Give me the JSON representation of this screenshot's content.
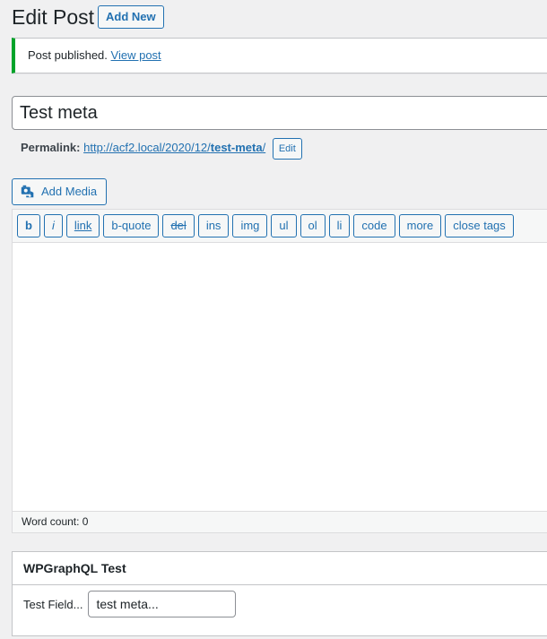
{
  "header": {
    "title": "Edit Post",
    "add_new_label": "Add New"
  },
  "notice": {
    "message": "Post published.",
    "link_label": "View post",
    "accent_color": "#00a32a"
  },
  "post": {
    "title_value": "Test meta",
    "permalink_label": "Permalink:",
    "permalink_base": "http://acf2.local/2020/12/",
    "permalink_slug": "test-meta",
    "permalink_trailing": "/",
    "edit_slug_label": "Edit"
  },
  "editor": {
    "add_media_label": "Add Media",
    "add_media_icon": "media-camera-icon",
    "quicktags": [
      {
        "label": "b"
      },
      {
        "label": "i"
      },
      {
        "label": "link"
      },
      {
        "label": "b-quote"
      },
      {
        "label": "del"
      },
      {
        "label": "ins"
      },
      {
        "label": "img"
      },
      {
        "label": "ul"
      },
      {
        "label": "ol"
      },
      {
        "label": "li"
      },
      {
        "label": "code"
      },
      {
        "label": "more"
      },
      {
        "label": "close tags"
      }
    ],
    "content": "",
    "word_count_label": "Word count: 0"
  },
  "metabox": {
    "title": "WPGraphQL Test",
    "field_label": "Test Field...",
    "field_value": "test meta..."
  },
  "colors": {
    "accent": "#2271b1",
    "background": "#f0f0f1"
  }
}
